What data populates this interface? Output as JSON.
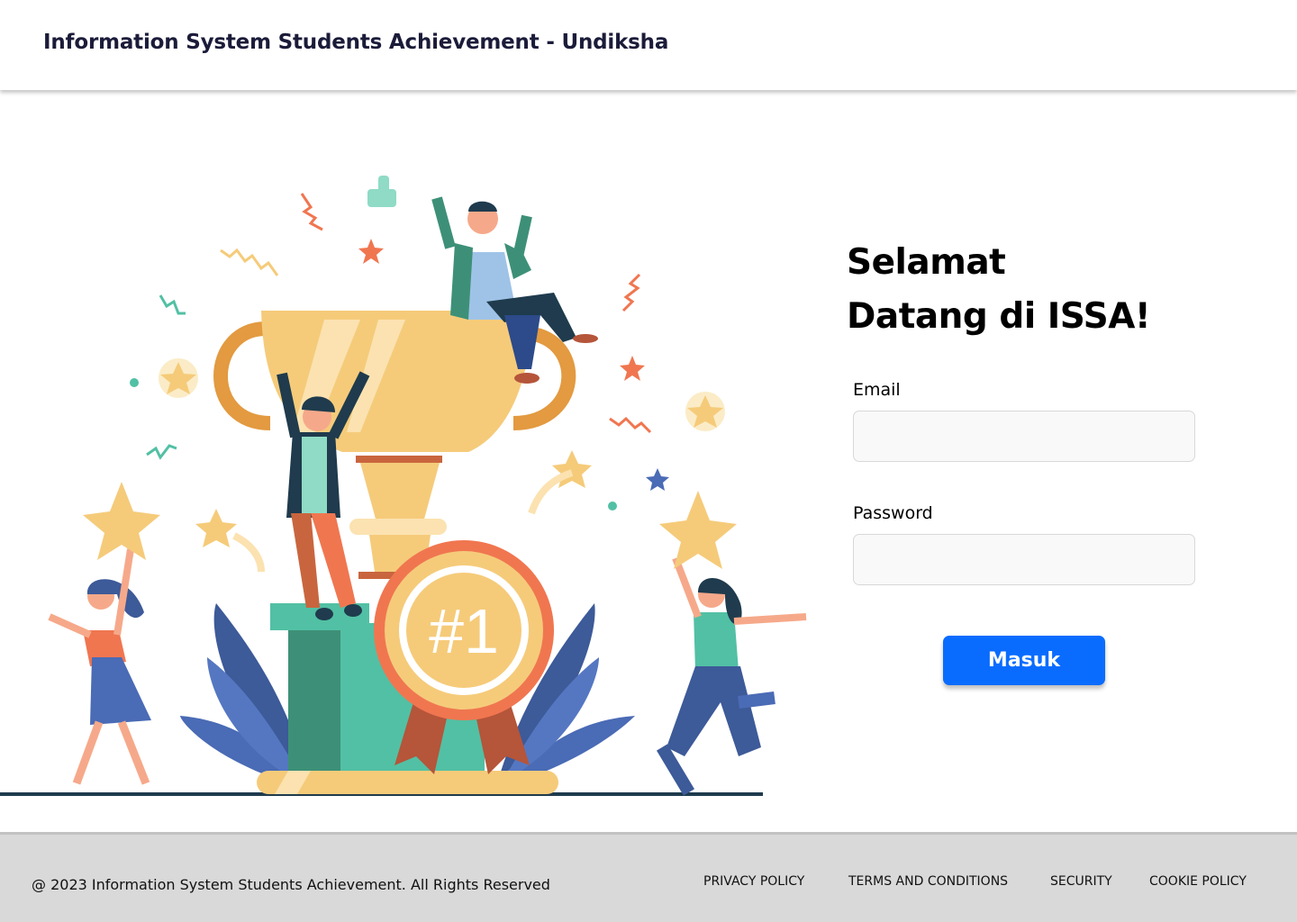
{
  "header": {
    "title": "Information System Students Achievement - Undiksha"
  },
  "illustration": {
    "name": "trophy-celebration-illustration",
    "badge_text": "#1"
  },
  "login": {
    "welcome_line1": "Selamat",
    "welcome_line2": "Datang di ISSA!",
    "email_label": "Email",
    "email_value": "",
    "password_label": "Password",
    "password_value": "",
    "submit_label": "Masuk"
  },
  "footer": {
    "copyright": "@ 2023 Information System Students Achievement. All Rights Reserved",
    "links": [
      {
        "label": "PRIVACY POLICY"
      },
      {
        "label": "TERMS AND CONDITIONS"
      },
      {
        "label": "SECURITY"
      },
      {
        "label": "COOKIE POLICY"
      }
    ]
  },
  "colors": {
    "primary_button": "#0a6cff",
    "footer_bg": "#d9d9d9",
    "title_text": "#1b1b3a"
  }
}
